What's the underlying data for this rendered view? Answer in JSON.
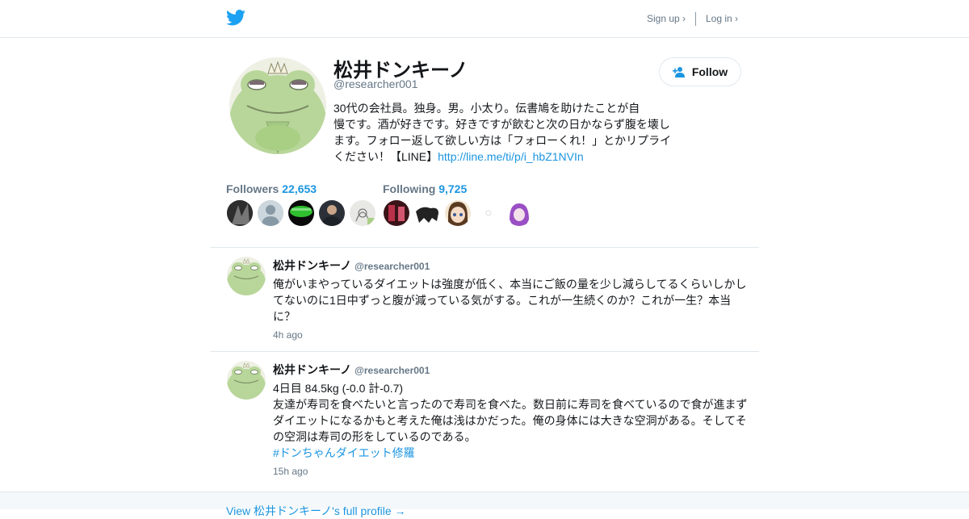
{
  "nav": {
    "signup_label": "Sign up ›",
    "login_label": "Log in ›"
  },
  "profile": {
    "name": "松井ドンキーノ",
    "handle": "@researcher001",
    "bio_lines": [
      "30代の会社員。独身。男。小太り。伝書鳩を助けたことが自",
      "慢です。酒が好きです。好きですが飲むと次の日かならず腹を壊し",
      "ます。フォロー返して欲しい方は「フォローくれ！」とかリプライ",
      "ください！【LINE】"
    ],
    "bio_link": "http://line.me/ti/p/i_hbZ1NVIn",
    "follow_label": "Follow"
  },
  "stats": {
    "followers_label": "Followers",
    "followers_count": "22,653",
    "following_label": "Following",
    "following_count": "9,725"
  },
  "tweets": [
    {
      "name": "松井ドンキーノ",
      "handle": "@researcher001",
      "text": "俺がいまやっているダイエットは強度が低く、本当にご飯の量を少し減らしてるくらいしかしてないのに1日中ずっと腹が減っている気がする。これが一生続くのか？これが一生？本当に？",
      "time": "4h ago"
    },
    {
      "name": "松井ドンキーノ",
      "handle": "@researcher001",
      "line1": "4日目 84.5kg (-0.0 計-0.7)",
      "text": "友達が寿司を食べたいと言ったので寿司を食べた。数日前に寿司を食べているので食が進まずダイエットになるかもと考えた俺は浅はかだった。俺の身体には大きな空洞がある。そしてその空洞は寿司の形をしているのである。",
      "hashtag": "#ドンちゃんダイエット修羅",
      "time": "15h ago"
    }
  ],
  "footer": {
    "full_profile_label": "View 松井ドンキーノ's full profile →"
  },
  "colors": {
    "accent": "#1b95e0",
    "text": "#14171a",
    "muted": "#657786",
    "border": "#e1e8ed",
    "frog": "#a9cf85"
  },
  "icons": [
    "twitter-bird-icon",
    "follow-user-plus-icon"
  ]
}
